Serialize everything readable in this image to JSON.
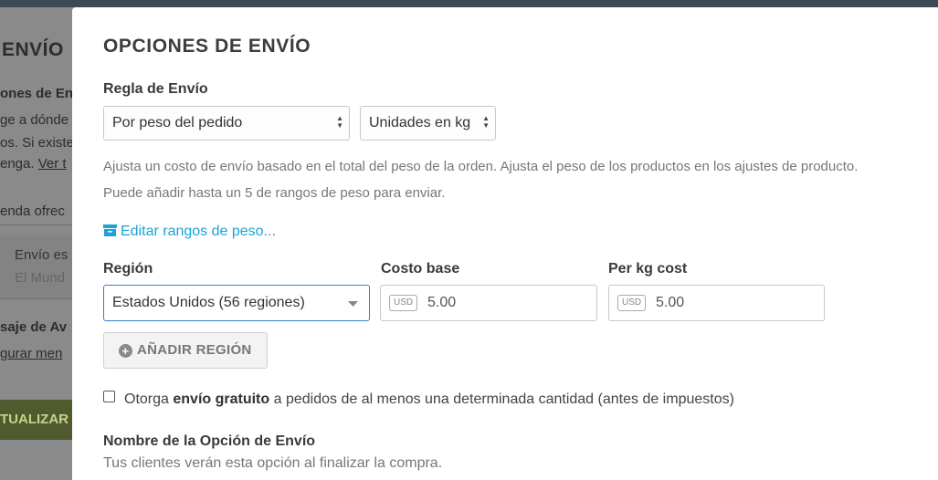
{
  "background": {
    "title": "ENVÍO",
    "line1": "ones de En",
    "line2": "ge a dónde",
    "line3": "os. Si existe",
    "line4_prefix": "enga.",
    "line4_link": "Ver t",
    "line5": "enda ofrec",
    "panel_title": "Envío es",
    "panel_sub": "El Mund",
    "line6": "saje de Av",
    "line7_link": "gurar men",
    "update_button": "TUALIZAR"
  },
  "modal": {
    "title": "OPCIONES DE ENVÍO",
    "rule_label": "Regla de Envío",
    "rule_select": "Por peso del pedido",
    "units_select": "Unidades en kg",
    "help_line1": "Ajusta un costo de envío basado en el total del peso de la orden. Ajusta el peso de los productos en los ajustes de producto.",
    "help_line2": "Puede añadir hasta un 5 de rangos de peso para enviar.",
    "edit_ranges_link": "Editar rangos de peso...",
    "region_label": "Región",
    "base_cost_label": "Costo base",
    "per_kg_label": "Per kg cost",
    "region_select": "Estados Unidos (56 regiones)",
    "currency": "USD",
    "base_cost_value": "5.00",
    "per_kg_value": "5.00",
    "add_region_button": "AÑADIR REGIÓN",
    "free_shipping_prefix": "Otorga",
    "free_shipping_bold": "envío gratuito",
    "free_shipping_suffix": "a pedidos de al menos una determinada cantidad (antes de impuestos)",
    "option_name_label": "Nombre de la Opción de Envío",
    "option_name_help": "Tus clientes verán esta opción al finalizar la compra.",
    "free_shipping_checked": false
  },
  "icons": {
    "edit_ranges": "archive-box-icon",
    "add_region": "plus-circle-icon",
    "dropdown": "caret-down-icon"
  },
  "colors": {
    "link": "#1aa3d6",
    "focus_border": "#3a7bd5",
    "overlay": "#8a8a8a"
  }
}
